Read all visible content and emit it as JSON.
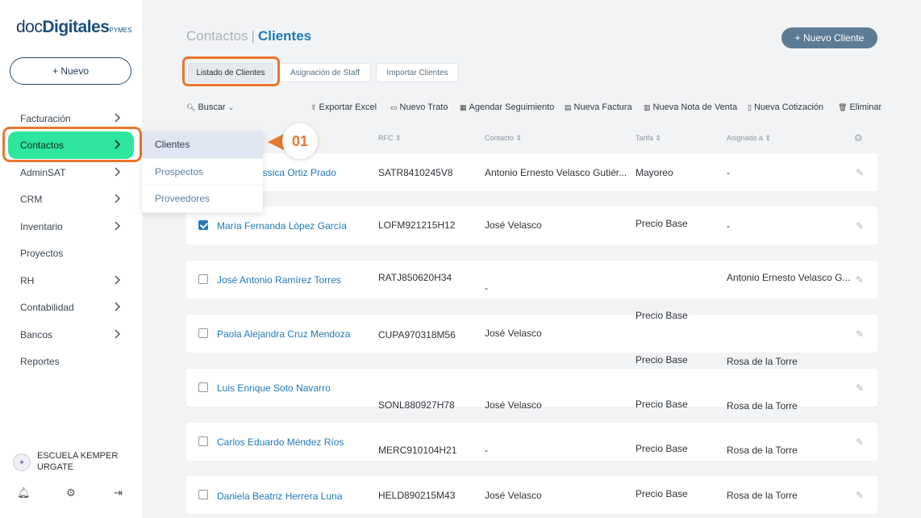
{
  "brand": {
    "prefix": "doc",
    "bold": "Digitales",
    "suffix": "PYMES"
  },
  "sidebar": {
    "new_button": "+ Nuevo",
    "items": [
      {
        "label": "Facturación",
        "has_chevron": true
      },
      {
        "label": "Contactos",
        "has_chevron": true,
        "active": true
      },
      {
        "label": "AdminSAT",
        "has_chevron": true
      },
      {
        "label": "CRM",
        "has_chevron": true
      },
      {
        "label": "Inventario",
        "has_chevron": true
      },
      {
        "label": "Proyectos",
        "has_chevron": false
      },
      {
        "label": "RH",
        "has_chevron": true
      },
      {
        "label": "Contabilidad",
        "has_chevron": true
      },
      {
        "label": "Bancos",
        "has_chevron": true
      },
      {
        "label": "Reportes",
        "has_chevron": false
      }
    ],
    "school_name": "ESCUELA KEMPER URGATE"
  },
  "submenu": [
    "Clientes",
    "Prospectos",
    "Proveedores"
  ],
  "callout": "01",
  "header": {
    "breadcrumb_parent": "Contactos",
    "breadcrumb_sep": "|",
    "breadcrumb_current": "Clientes",
    "new_client": "+ Nuevo Cliente"
  },
  "tabs": [
    "Listado de Clientes",
    "Asignación de Staff",
    "Importar Clientes"
  ],
  "toolbar": {
    "search": "Buscar",
    "export": "Exportar Excel",
    "new_deal": "Nuevo Trato",
    "schedule": "Agendar Seguimiento",
    "new_invoice": "Nueva Factura",
    "new_sale_note": "Nueva Nota de Venta",
    "new_quote": "Nueva Cotización",
    "delete": "Eliminar"
  },
  "columns": {
    "rfc": "RFC",
    "contacto": "Contacto",
    "tarifa": "Tarifa",
    "asignado": "Asignado a"
  },
  "rows": [
    {
      "name": "Jessica Ortiz Prado",
      "rfc": "SATR8410245V8",
      "contacto": "Antonio Ernesto Velasco Gutiér...",
      "tarifa": "Mayoreo",
      "asignado": "-",
      "checked": false
    },
    {
      "name": "María Fernanda López García",
      "rfc": "LOFM921215H12",
      "contacto": "José Velasco",
      "tarifa": "Precio Base",
      "asignado": "-",
      "checked": true
    },
    {
      "name": "José Antonio Ramírez Torres",
      "rfc": "RATJ850620H34",
      "contacto": "-",
      "tarifa": "",
      "asignado": "Antonio Ernesto Velasco G...",
      "checked": false
    },
    {
      "name": "Paola Alejandra Cruz Mendoza",
      "rfc": "CUPA970318M56",
      "contacto": "José Velasco",
      "tarifa": "Precio Base",
      "asignado": "",
      "checked": false
    },
    {
      "name": "Luis Enrique Soto Navarro",
      "rfc": "SONL880927H78",
      "contacto": "José Velasco",
      "tarifa": "Precio Base",
      "asignado": "Rosa de la Torre",
      "checked": false
    },
    {
      "name": "Carlos Eduardo Méndez Ríos",
      "rfc": "MERC910104H21",
      "contacto": "-",
      "tarifa": "Precio Base",
      "asignado": "Rosa de la Torre",
      "checked": false
    },
    {
      "name": "Daniela Beatriz Herrera Luna",
      "rfc": "HELD890215M43",
      "contacto": "José Velasco",
      "tarifa": "Precio Base",
      "asignado": "Rosa de la Torre",
      "checked": false
    }
  ],
  "floating_cells": {
    "tarifa_a": "Precio Base",
    "tarifa_b": "Precio Base",
    "asignado_a": "Rosa de la Torre"
  },
  "colors": {
    "accent": "#1f7ab8",
    "active_menu": "#2ee59d",
    "highlight": "#e8772e",
    "primary_button": "#5d7b95"
  }
}
